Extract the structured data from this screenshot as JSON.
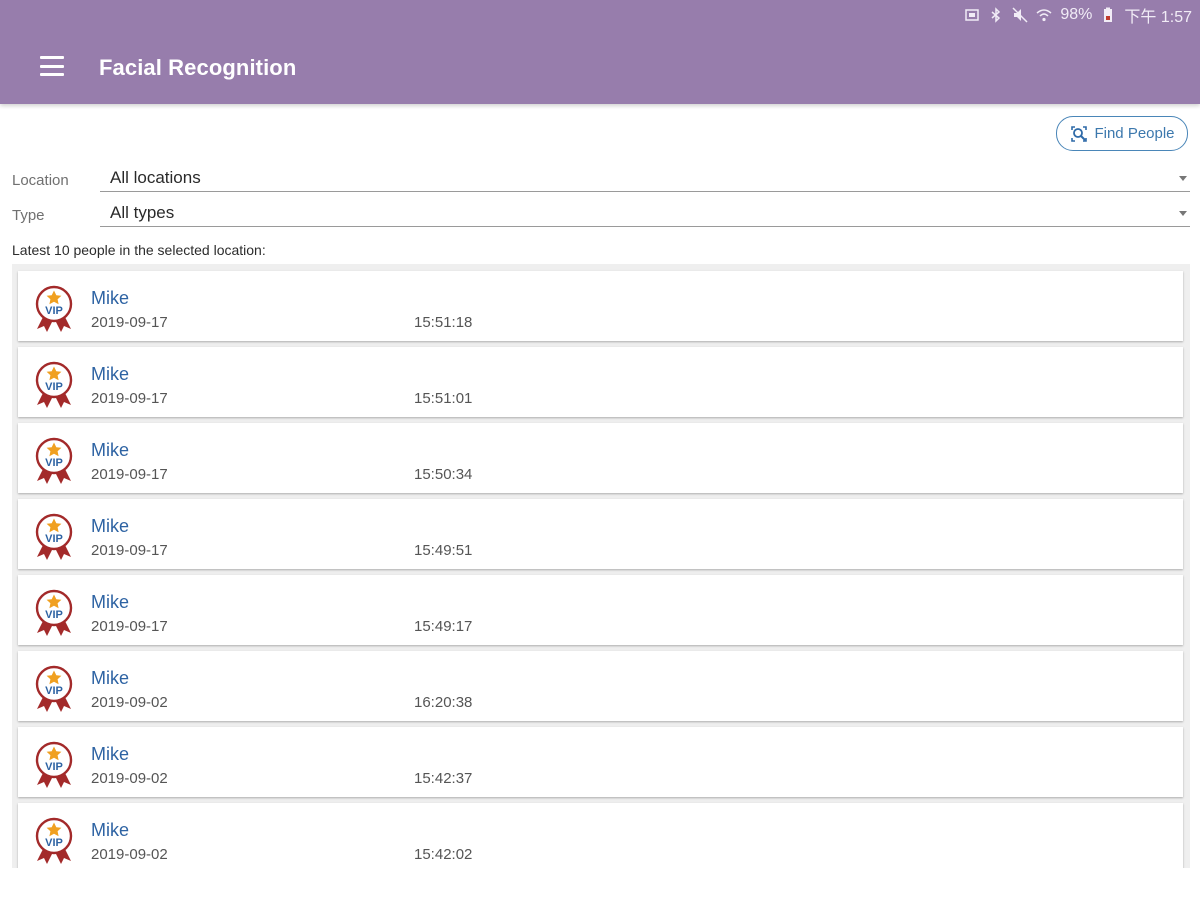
{
  "status_bar": {
    "battery": "98%",
    "time": "下午 1:57"
  },
  "app_bar": {
    "title": "Facial Recognition",
    "menu_icon": "hamburger-menu-icon"
  },
  "find_button": {
    "label": "Find People",
    "icon": "face-search-icon"
  },
  "filters": {
    "location": {
      "label": "Location",
      "value": "All locations"
    },
    "type": {
      "label": "Type",
      "value": "All types"
    }
  },
  "list_caption": "Latest 10 people in the selected location:",
  "people": [
    {
      "name": "Mike",
      "date": "2019-09-17",
      "time": "15:51:18",
      "badge": "VIP"
    },
    {
      "name": "Mike",
      "date": "2019-09-17",
      "time": "15:51:01",
      "badge": "VIP"
    },
    {
      "name": "Mike",
      "date": "2019-09-17",
      "time": "15:50:34",
      "badge": "VIP"
    },
    {
      "name": "Mike",
      "date": "2019-09-17",
      "time": "15:49:51",
      "badge": "VIP"
    },
    {
      "name": "Mike",
      "date": "2019-09-17",
      "time": "15:49:17",
      "badge": "VIP"
    },
    {
      "name": "Mike",
      "date": "2019-09-02",
      "time": "16:20:38",
      "badge": "VIP"
    },
    {
      "name": "Mike",
      "date": "2019-09-02",
      "time": "15:42:37",
      "badge": "VIP"
    },
    {
      "name": "Mike",
      "date": "2019-09-02",
      "time": "15:42:02",
      "badge": "VIP"
    }
  ],
  "colors": {
    "app_bar": "#977dac",
    "accent_blue": "#3c78ad",
    "vip_red": "#a32a2a",
    "vip_star": "#f0a020"
  }
}
